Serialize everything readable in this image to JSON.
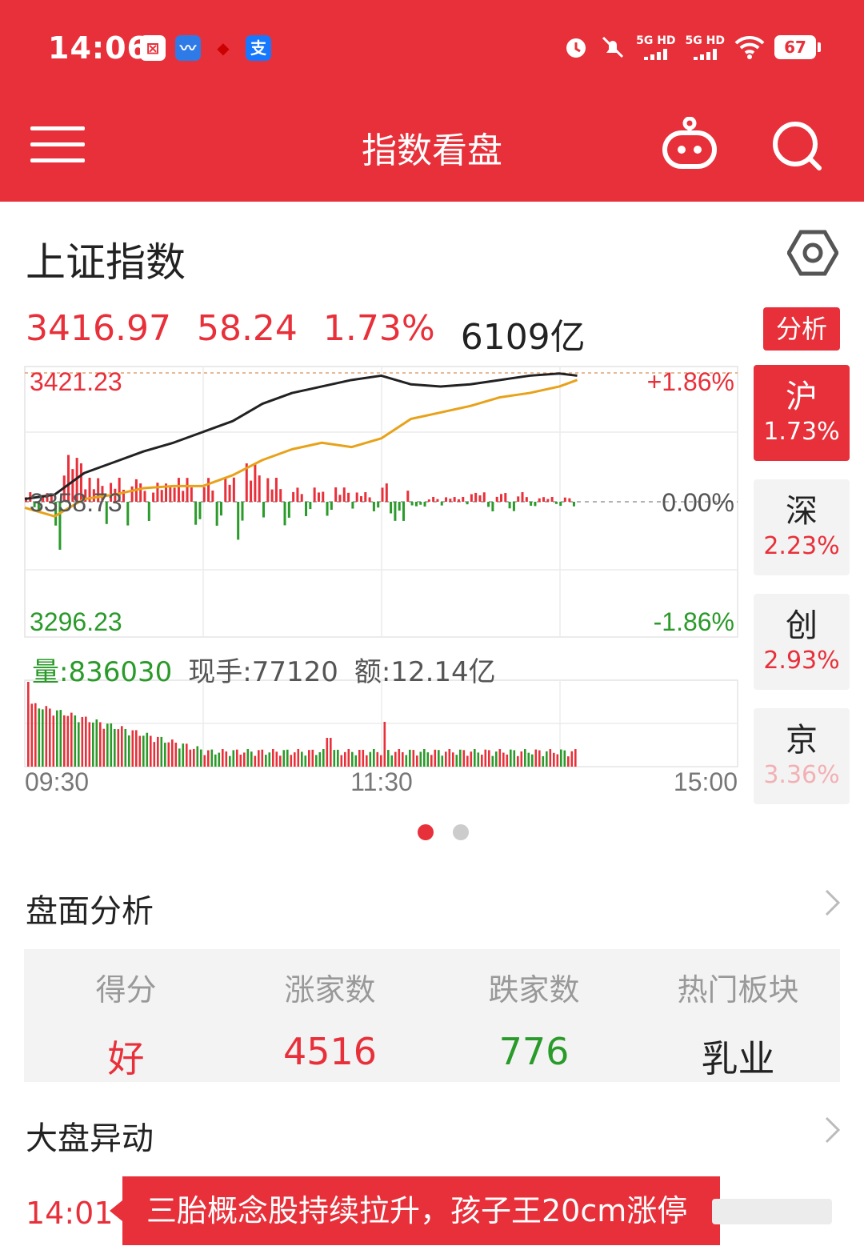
{
  "status_bar": {
    "time": "14:06",
    "network_1": "5G HD",
    "network_2": "5G HD",
    "battery": "67"
  },
  "header": {
    "title": "指数看盘"
  },
  "index": {
    "name": "上证指数",
    "price": "3416.97",
    "change": "58.24",
    "change_pct": "1.73%",
    "amount": "6109亿",
    "analysis_label": "分析"
  },
  "markets": [
    {
      "name": "沪",
      "pct": "1.73%",
      "active": true
    },
    {
      "name": "深",
      "pct": "2.23%",
      "active": false
    },
    {
      "name": "创",
      "pct": "2.93%",
      "active": false
    },
    {
      "name": "京",
      "pct": "3.36%",
      "active": false
    }
  ],
  "chart_data": {
    "type": "line",
    "y_left_ticks": [
      "3421.23",
      "3358.73",
      "3296.23"
    ],
    "y_right_ticks": [
      "+1.86%",
      "0.00%",
      "-1.86%"
    ],
    "x_ticks": [
      "09:30",
      "11:30",
      "15:00"
    ],
    "ylim": [
      3296.23,
      3421.23
    ],
    "prev_close": 3358.73,
    "series": [
      {
        "color": "#222222",
        "x": [
          "09:30",
          "09:40",
          "09:50",
          "10:00",
          "10:10",
          "10:20",
          "10:30",
          "10:40",
          "10:50",
          "11:00",
          "11:10",
          "11:20",
          "11:30",
          "13:10",
          "13:20",
          "13:30",
          "13:40",
          "13:50",
          "14:00",
          "14:06"
        ],
        "values": [
          3360,
          3362,
          3372,
          3377,
          3382,
          3386,
          3391,
          3396,
          3404,
          3409,
          3412,
          3415,
          3417,
          3413,
          3412,
          3413,
          3415,
          3417,
          3418,
          3417
        ]
      },
      {
        "color": "#e8a21a",
        "x": [
          "09:30",
          "09:40",
          "09:50",
          "10:00",
          "10:10",
          "10:20",
          "10:30",
          "10:40",
          "10:50",
          "11:00",
          "11:10",
          "11:20",
          "11:30",
          "13:10",
          "13:20",
          "13:30",
          "13:40",
          "13:50",
          "14:00",
          "14:06"
        ],
        "values": [
          3356,
          3352,
          3360,
          3362,
          3365,
          3366,
          3366,
          3371,
          3378,
          3383,
          3386,
          3384,
          3388,
          3397,
          3400,
          3403,
          3407,
          3409,
          3412,
          3415
        ]
      }
    ],
    "volume": {
      "total": "量:836030",
      "last": "现手:77120",
      "turnover": "额:12.14亿"
    }
  },
  "pager": {
    "pages": 2,
    "current": 0
  },
  "panel": {
    "title": "盘面分析",
    "columns": [
      {
        "header": "得分",
        "value": "好",
        "color": "red"
      },
      {
        "header": "涨家数",
        "value": "4516",
        "color": "red"
      },
      {
        "header": "跌家数",
        "value": "776",
        "color": "green"
      },
      {
        "header": "热门板块",
        "value": "乳业",
        "color": "dark"
      }
    ]
  },
  "movements": {
    "title": "大盘异动",
    "items": [
      {
        "time": "14:01",
        "text": "三胎概念股持续拉升，孩子王20cm涨停"
      }
    ]
  },
  "colors": {
    "brand": "#e8303a",
    "up": "#e8303a",
    "down": "#2a9a2a",
    "avg_line": "#e8a21a"
  }
}
